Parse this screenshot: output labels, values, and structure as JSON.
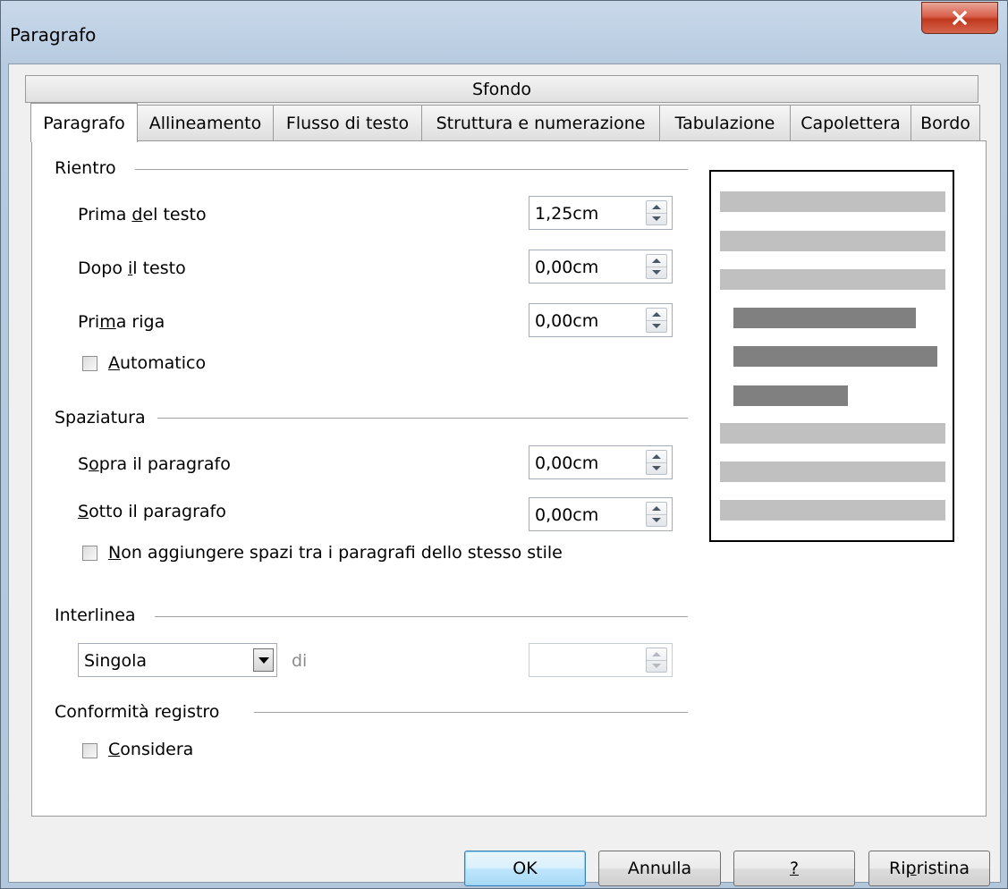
{
  "window": {
    "title": "Paragrafo"
  },
  "tabs": {
    "top": "Sfondo",
    "items": [
      "Paragrafo",
      "Allineamento",
      "Flusso di testo",
      "Struttura e numerazione",
      "Tabulazione",
      "Capolettera",
      "Bordo"
    ],
    "active": "Paragrafo"
  },
  "rientro": {
    "title": "Rientro",
    "prima_testo": {
      "pre": "Prima ",
      "u": "d",
      "post": "el testo",
      "value": "1,25cm"
    },
    "dopo_testo": {
      "pre": "Dopo ",
      "u": "i",
      "post": "l testo",
      "value": "0,00cm"
    },
    "prima_riga": {
      "pre": "Pri",
      "u": "m",
      "post": "a riga",
      "value": "0,00cm"
    },
    "automatico": {
      "pre": "",
      "u": "A",
      "post": "utomatico",
      "checked": false
    }
  },
  "spaziatura": {
    "title": "Spaziatura",
    "sopra": {
      "pre": "S",
      "u": "o",
      "post": "pra il paragrafo",
      "value": "0,00cm"
    },
    "sotto": {
      "pre": "",
      "u": "S",
      "post": "otto il paragrafo",
      "value": "0,00cm"
    },
    "non_aggiungere": {
      "pre": "",
      "u": "N",
      "post": "on aggiungere spazi tra i paragrafi dello stesso stile",
      "checked": false
    }
  },
  "interlinea": {
    "title": "Interlinea",
    "selected": "Singola",
    "di_label": "di",
    "value": ""
  },
  "registro": {
    "title": "Conformità registro",
    "considera": {
      "pre": "",
      "u": "C",
      "post": "onsidera",
      "checked": false
    }
  },
  "buttons": {
    "ok": "OK",
    "annulla": "Annulla",
    "help": "?",
    "ripristina_pre": "Ri",
    "ripristina_u": "p",
    "ripristina_post": "ristina"
  },
  "colors": {
    "preview_light": "#c0c0c0",
    "preview_dark": "#808080"
  }
}
